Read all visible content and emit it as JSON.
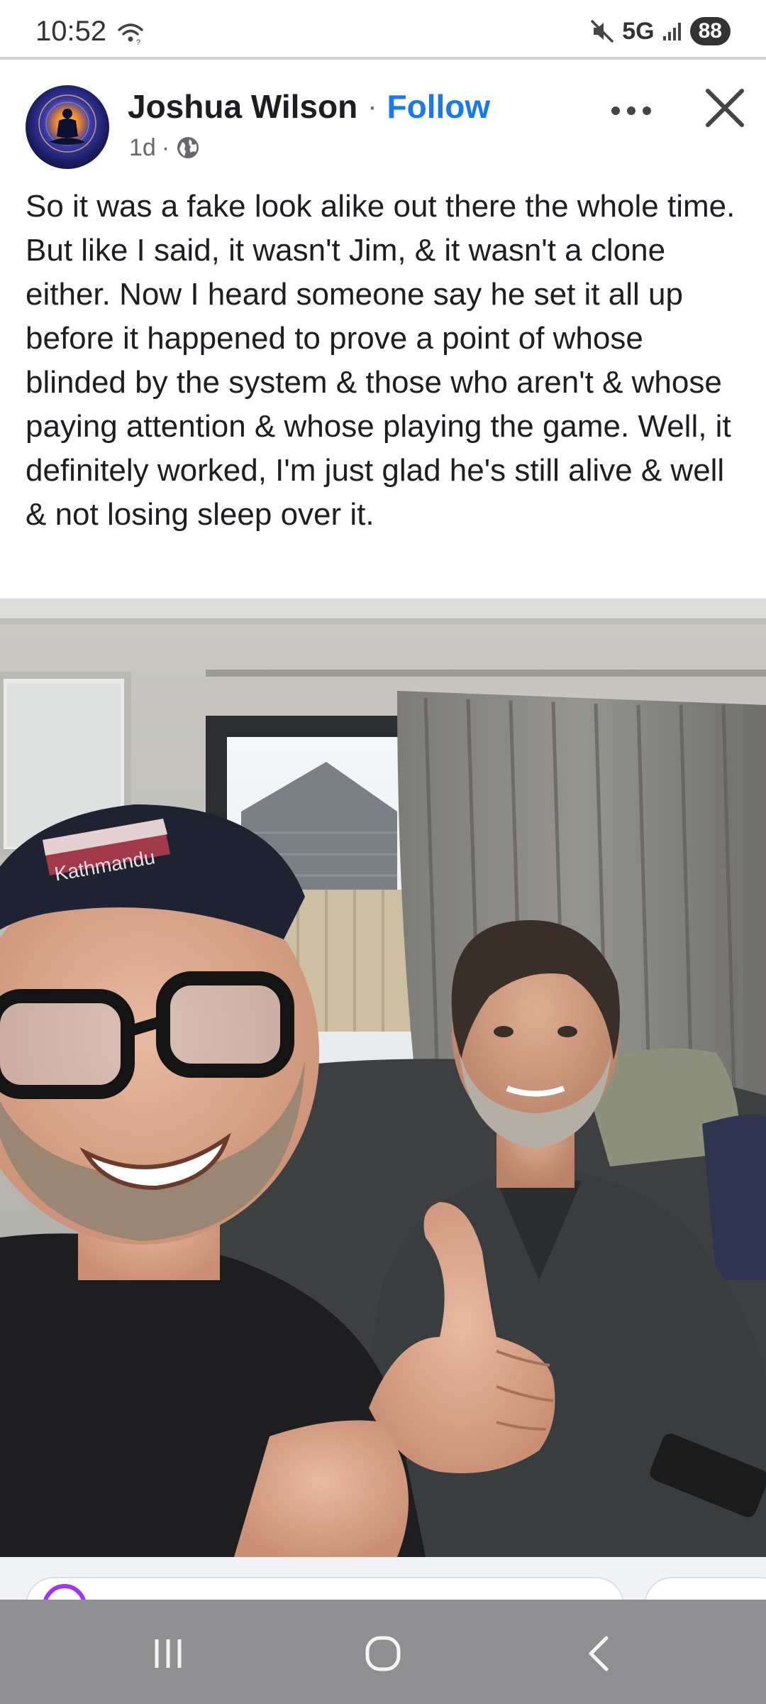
{
  "status_bar": {
    "time": "10:52",
    "network": "5G",
    "battery": "88",
    "icons": [
      "wifi-icon",
      "mute-icon",
      "signal-icon"
    ]
  },
  "post": {
    "author": "Joshua Wilson",
    "separator": "·",
    "follow_label": "Follow",
    "time_ago": "1d",
    "meta_separator": "·",
    "privacy_icon": "globe-icon",
    "text": "So it was a fake look alike out there the whole time. But like I said, it wasn't Jim, & it wasn't a clone either. Now I heard someone say he set it all up before it happened to prove a point of whose blinded by the system & those who aren't & whose paying attention & whose playing the game. Well, it definitely worked, I'm just glad he's still alive & well & not losing sleep over it.",
    "photo": {
      "hat_text": "Kathmandu"
    }
  },
  "colors": {
    "link_blue": "#1877f2",
    "text_primary": "#1c1e21",
    "text_secondary": "#65676b",
    "nav_bar": "#8f8f91"
  },
  "nav_bar": {
    "icons": [
      "recent-apps-icon",
      "home-icon",
      "back-icon"
    ]
  }
}
